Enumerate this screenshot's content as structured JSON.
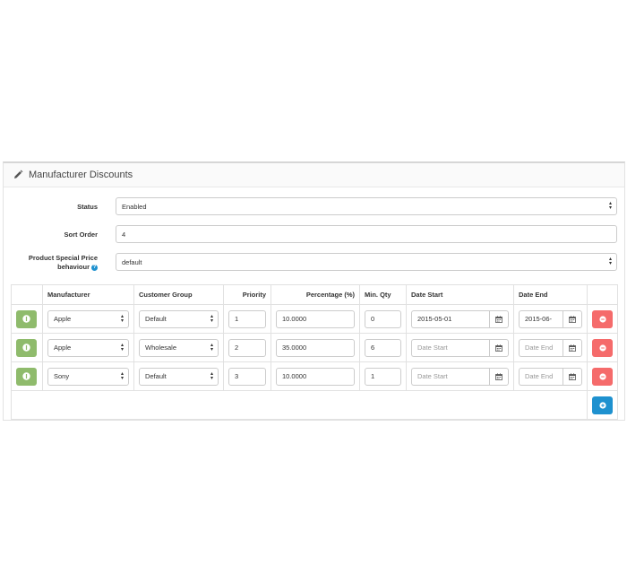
{
  "panel": {
    "title": "Manufacturer Discounts",
    "icon": "pencil-icon"
  },
  "form": {
    "status_label": "Status",
    "status_value": "Enabled",
    "sort_order_label": "Sort Order",
    "sort_order_value": "4",
    "special_price_label_line1": "Product Special Price",
    "special_price_label_line2": "behaviour",
    "special_price_value": "default"
  },
  "table": {
    "headers": {
      "manufacturer": "Manufacturer",
      "customer_group": "Customer Group",
      "priority": "Priority",
      "percentage": "Percentage (%)",
      "min_qty": "Min. Qty",
      "date_start": "Date Start",
      "date_end": "Date End"
    },
    "date_start_placeholder": "Date Start",
    "date_end_placeholder": "Date End",
    "rows": [
      {
        "manufacturer": "Apple",
        "customer_group": "Default",
        "priority": "1",
        "percentage": "10.0000",
        "min_qty": "0",
        "date_start": "2015-05-01",
        "date_end": "2015-06-"
      },
      {
        "manufacturer": "Apple",
        "customer_group": "Wholesale",
        "priority": "2",
        "percentage": "35.0000",
        "min_qty": "6",
        "date_start": "",
        "date_end": ""
      },
      {
        "manufacturer": "Sony",
        "customer_group": "Default",
        "priority": "3",
        "percentage": "10.0000",
        "min_qty": "1",
        "date_start": "",
        "date_end": ""
      }
    ]
  },
  "colors": {
    "info_button": "#8fbb6c",
    "remove_button": "#f56b6b",
    "add_button": "#1e91cf"
  }
}
